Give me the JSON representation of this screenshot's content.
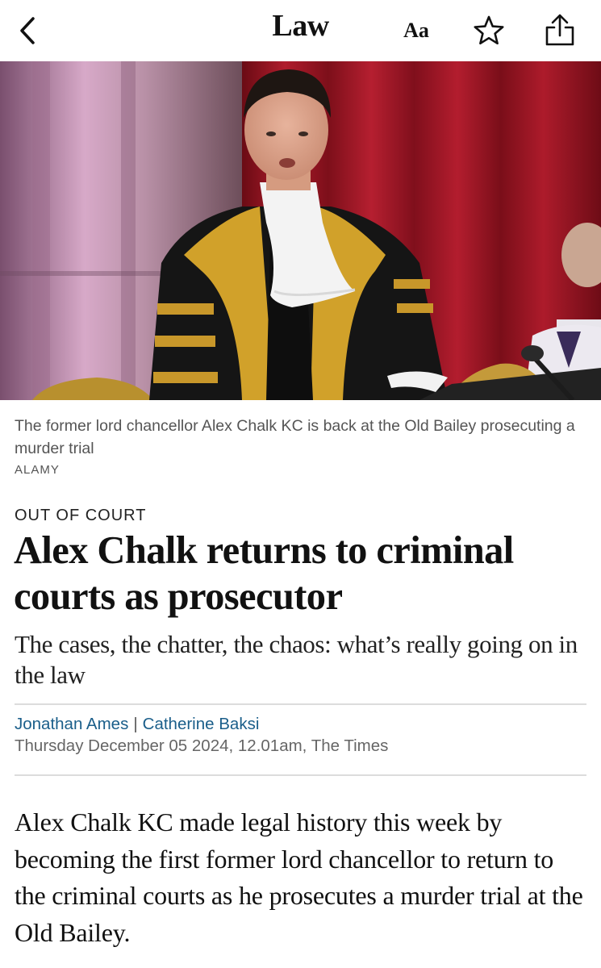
{
  "topbar": {
    "back_icon": "chevron-left-icon",
    "section_title": "Law",
    "font_size_label": "Aa",
    "bookmark_icon": "star-icon",
    "share_icon": "share-icon"
  },
  "hero": {
    "colors": {
      "curtain": "#a01828",
      "wall": "#b98aa8",
      "robe": "#161616",
      "gold": "#d4a52a",
      "lace": "#f4f4f4"
    }
  },
  "caption": {
    "text": "The former lord chancellor Alex Chalk KC is back at the Old Bailey prosecuting a murder trial",
    "credit": "ALAMY"
  },
  "article": {
    "kicker": "OUT OF COURT",
    "headline": "Alex Chalk returns to criminal courts as prosecutor",
    "standfirst": "The cases, the chatter, the chaos: what’s really going on in the law",
    "authors": [
      "Jonathan Ames",
      "Catherine Baksi"
    ],
    "author_separator": "|",
    "dateline": "Thursday December 05 2024, 12.01am, The Times",
    "body": "Alex Chalk KC made legal history this week by becoming the first former lord chancellor to return to the criminal courts as he prosecutes a murder trial at the Old Bailey.",
    "link_color": "#1a5e8a"
  }
}
